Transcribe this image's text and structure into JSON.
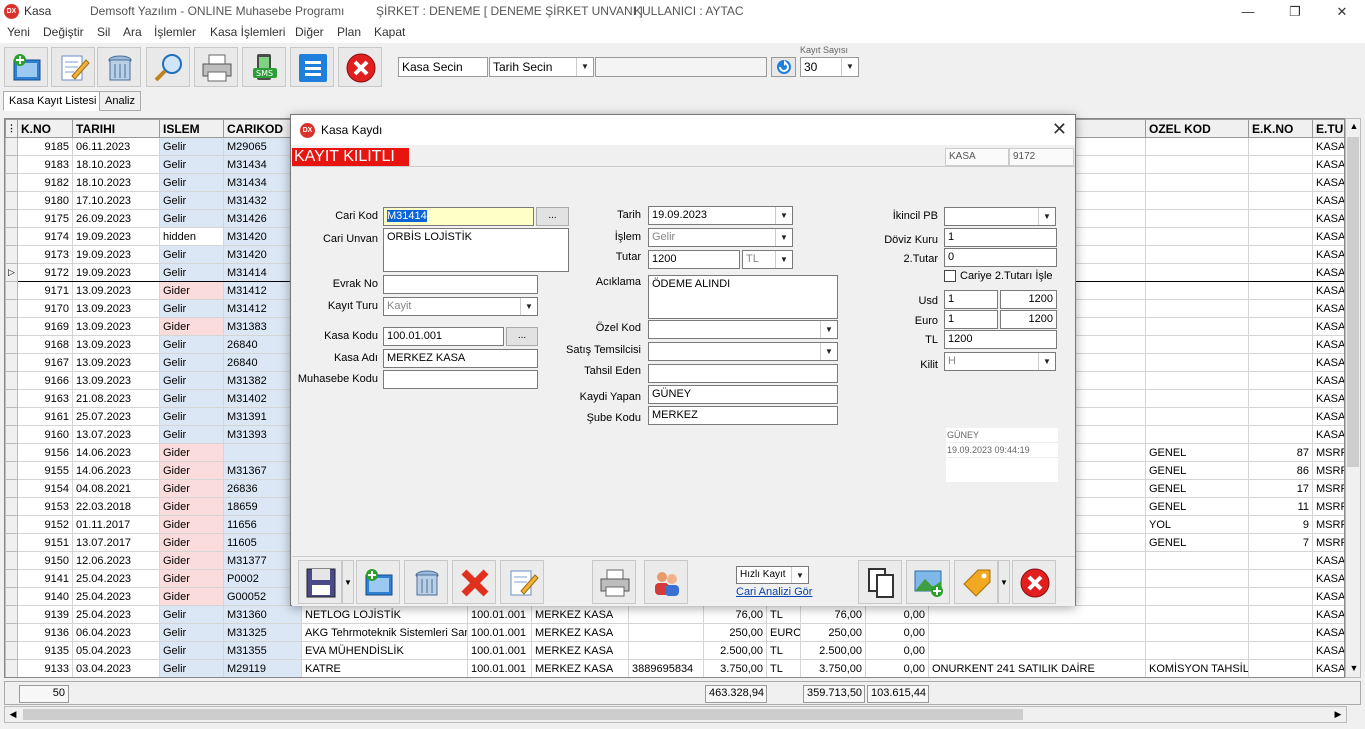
{
  "window": {
    "app_name": "Kasa",
    "company_app": "Demsoft Yazılım - ONLINE Muhasebe Programı",
    "company": "ŞİRKET : DENEME [ DENEME ŞİRKET UNVANI ]",
    "user": "KULLANICI : AYTAC",
    "icon_text": "DX"
  },
  "menu": [
    "Yeni",
    "Değiştir",
    "Sil",
    "Ara",
    "İşlemler",
    "Kasa İşlemleri",
    "Diğer",
    "Plan",
    "Kapat"
  ],
  "toolbar": {
    "kasa_select": "Kasa Secin",
    "date_select": "Tarih Secin",
    "record_count_label": "Kayıt Sayısı",
    "record_count": "30"
  },
  "tabs": [
    "Kasa Kayıt Listesi",
    "Analiz"
  ],
  "grid": {
    "columns": [
      "K.NO",
      "TARIHI",
      "ISLEM",
      "CARIKOD",
      "",
      "",
      "",
      "",
      "",
      "",
      "",
      "",
      "",
      "OZEL KOD",
      "E.K.NO",
      "E.TU"
    ],
    "rows": [
      {
        "kno": "9185",
        "date": "06.11.2023",
        "islem": "Gelir",
        "cari": "M29065",
        "ozel": "",
        "ekno": "",
        "etu": "KASA"
      },
      {
        "kno": "9183",
        "date": "18.10.2023",
        "islem": "Gelir",
        "cari": "M31434",
        "ozel": "",
        "ekno": "",
        "etu": "KASA"
      },
      {
        "kno": "9182",
        "date": "18.10.2023",
        "islem": "Gelir",
        "cari": "M31434",
        "ozel": "",
        "ekno": "",
        "etu": "KASA"
      },
      {
        "kno": "9180",
        "date": "17.10.2023",
        "islem": "Gelir",
        "cari": "M31432",
        "ozel": "",
        "ekno": "",
        "etu": "KASA"
      },
      {
        "kno": "9175",
        "date": "26.09.2023",
        "islem": "Gelir",
        "cari": "M31426",
        "ozel": "",
        "ekno": "",
        "etu": "KASA"
      },
      {
        "kno": "9174",
        "date": "19.09.2023",
        "islem": "hidden",
        "cari": "M31420",
        "ozel": "",
        "ekno": "",
        "etu": "KASA"
      },
      {
        "kno": "9173",
        "date": "19.09.2023",
        "islem": "Gelir",
        "cari": "M31420",
        "ozel": "",
        "ekno": "",
        "etu": "KASA"
      },
      {
        "kno": "9172",
        "date": "19.09.2023",
        "islem": "Gelir",
        "cari": "M31414",
        "ozel": "",
        "ekno": "",
        "etu": "KASA",
        "current": true
      },
      {
        "kno": "9171",
        "date": "13.09.2023",
        "islem": "Gider",
        "cari": "M31412",
        "ozel": "",
        "ekno": "",
        "etu": "KASA"
      },
      {
        "kno": "9170",
        "date": "13.09.2023",
        "islem": "Gelir",
        "cari": "M31412",
        "ozel": "",
        "ekno": "",
        "etu": "KASA"
      },
      {
        "kno": "9169",
        "date": "13.09.2023",
        "islem": "Gider",
        "cari": "M31383",
        "ozel": "",
        "ekno": "",
        "etu": "KASA"
      },
      {
        "kno": "9168",
        "date": "13.09.2023",
        "islem": "Gelir",
        "cari": "26840",
        "ozel": "",
        "ekno": "",
        "etu": "KASA"
      },
      {
        "kno": "9167",
        "date": "13.09.2023",
        "islem": "Gelir",
        "cari": "26840",
        "ozel": "",
        "ekno": "",
        "etu": "KASA"
      },
      {
        "kno": "9166",
        "date": "13.09.2023",
        "islem": "Gelir",
        "cari": "M31382",
        "ozel": "",
        "ekno": "",
        "etu": "KASA"
      },
      {
        "kno": "9163",
        "date": "21.08.2023",
        "islem": "Gelir",
        "cari": "M31402",
        "ozel": "",
        "ekno": "",
        "etu": "KASA"
      },
      {
        "kno": "9161",
        "date": "25.07.2023",
        "islem": "Gelir",
        "cari": "M31391",
        "ozel": "",
        "ekno": "",
        "etu": "KASA"
      },
      {
        "kno": "9160",
        "date": "13.07.2023",
        "islem": "Gelir",
        "cari": "M31393",
        "ozel": "",
        "ekno": "",
        "etu": "KASA"
      },
      {
        "kno": "9156",
        "date": "14.06.2023",
        "islem": "Gider",
        "cari": "",
        "ozel": "GENEL",
        "ekno": "87",
        "etu": "MSRF"
      },
      {
        "kno": "9155",
        "date": "14.06.2023",
        "islem": "Gider",
        "cari": "M31367",
        "ozel": "GENEL",
        "ekno": "86",
        "etu": "MSRF"
      },
      {
        "kno": "9154",
        "date": "04.08.2021",
        "islem": "Gider",
        "cari": "26836",
        "ozel": "GENEL",
        "ekno": "17",
        "etu": "MSRF"
      },
      {
        "kno": "9153",
        "date": "22.03.2018",
        "islem": "Gider",
        "cari": "18659",
        "ozel": "GENEL",
        "ekno": "11",
        "etu": "MSRF"
      },
      {
        "kno": "9152",
        "date": "01.11.2017",
        "islem": "Gider",
        "cari": "11656",
        "ozel": "YOL",
        "ekno": "9",
        "etu": "MSRF"
      },
      {
        "kno": "9151",
        "date": "13.07.2017",
        "islem": "Gider",
        "cari": "11605",
        "ozel": "GENEL",
        "ekno": "7",
        "etu": "MSRF"
      },
      {
        "kno": "9150",
        "date": "12.06.2023",
        "islem": "Gider",
        "cari": "M31377",
        "ozel": "",
        "ekno": "",
        "etu": "KASA"
      },
      {
        "kno": "9141",
        "date": "25.04.2023",
        "islem": "Gider",
        "cari": "P0002",
        "ozel": "",
        "ekno": "",
        "etu": "KASA"
      },
      {
        "kno": "9140",
        "date": "25.04.2023",
        "islem": "Gider",
        "cari": "G00052",
        "ozel": "",
        "ekno": "",
        "etu": "KASA"
      },
      {
        "kno": "9139",
        "date": "25.04.2023",
        "islem": "Gelir",
        "cari": "M31360",
        "unvan": "NETLOG LOJİSTİK",
        "kod": "100.01.001",
        "kadi": "MERKEZ KASA",
        "evrak": "",
        "tutar": "76,00",
        "pb": "TL",
        "tl": "76,00",
        "t2": "0,00",
        "acik": "",
        "ozel": "",
        "ekno": "",
        "etu": "KASA"
      },
      {
        "kno": "9136",
        "date": "06.04.2023",
        "islem": "Gelir",
        "cari": "M31325",
        "unvan": "AKG Tehrmoteknik Sistemleri San.",
        "kod": "100.01.001",
        "kadi": "MERKEZ KASA",
        "evrak": "",
        "tutar": "250,00",
        "pb": "EURO",
        "tl": "250,00",
        "t2": "0,00",
        "acik": "",
        "ozel": "",
        "ekno": "",
        "etu": "KASA"
      },
      {
        "kno": "9135",
        "date": "05.04.2023",
        "islem": "Gelir",
        "cari": "M31355",
        "unvan": "EVA MÜHENDİSLİK",
        "kod": "100.01.001",
        "kadi": "MERKEZ KASA",
        "evrak": "",
        "tutar": "2.500,00",
        "pb": "TL",
        "tl": "2.500,00",
        "t2": "0,00",
        "acik": "",
        "ozel": "",
        "ekno": "",
        "etu": "KASA"
      },
      {
        "kno": "9133",
        "date": "03.04.2023",
        "islem": "Gelir",
        "cari": "M29119",
        "unvan": "KATRE",
        "kod": "100.01.001",
        "kadi": "MERKEZ KASA",
        "evrak": "3889695834",
        "tutar": "3.750,00",
        "pb": "TL",
        "tl": "3.750,00",
        "t2": "0,00",
        "acik": "ONURKENT 241 SATILIK DAİRE",
        "ozel": "KOMİSYON TAHSİLA",
        "ekno": "",
        "etu": "KASA"
      }
    ]
  },
  "footer": {
    "count": "50",
    "total1": "463.328,94",
    "total2": "359.713,50",
    "total3": "103.615,44"
  },
  "dialog": {
    "title": "Kasa Kaydı",
    "locked_label": "KAYIT KILITLI",
    "kasa_label": "KASA",
    "kasa_no": "9172",
    "fields": {
      "cari_kod_label": "Cari Kod",
      "cari_kod": "M31414",
      "cari_unvan_label": "Cari Unvan",
      "cari_unvan": "ORBİS LOJİSTİK",
      "evrak_no_label": "Evrak No",
      "evrak_no": "",
      "kayit_turu_label": "Kayıt Turu",
      "kayit_turu": "Kayit",
      "kasa_kodu_label": "Kasa  Kodu",
      "kasa_kodu": "100.01.001",
      "kasa_adi_label": "Kasa Adı",
      "kasa_adi": "MERKEZ KASA",
      "muhasebe_kodu_label": "Muhasebe Kodu",
      "muhasebe_kodu": "",
      "tarih_label": "Tarih",
      "tarih": "19.09.2023",
      "islem_label": "İşlem",
      "islem": "Gelir",
      "tutar_label": "Tutar",
      "tutar": "1200",
      "tutar_pb": "TL",
      "aciklama_label": "Acıklama",
      "aciklama": "ÖDEME ALINDI",
      "ozel_kod_label": "Özel Kod",
      "ozel_kod": "",
      "satis_label": "Satış Temsilcisi",
      "satis": "",
      "tahsil_label": "Tahsil Eden",
      "tahsil": "",
      "kaydi_yapan_label": "Kaydi Yapan",
      "kaydi_yapan": "GÜNEY",
      "sube_label": "Şube Kodu",
      "sube": "MERKEZ",
      "ikincil_label": "İkincil PB",
      "ikincil": "",
      "doviz_label": "Döviz Kuru",
      "doviz": "1",
      "tutar2_label": "2.Tutar",
      "tutar2": "0",
      "cariye_label": "Cariye 2.Tutarı İşle",
      "usd_label": "Usd",
      "usd_rate": "1",
      "usd_amount": "1200",
      "euro_label": "Euro",
      "euro_rate": "1",
      "euro_amount": "1200",
      "tl_label": "TL",
      "tl_amount": "1200",
      "kilit_label": "Kilit",
      "kilit": "H"
    },
    "info": {
      "user": "GÜNEY",
      "timestamp": "19.09.2023 09:44:19"
    },
    "quick_record": "Hızlı Kayıt",
    "cari_analiz": "Cari Analizi Gör"
  }
}
